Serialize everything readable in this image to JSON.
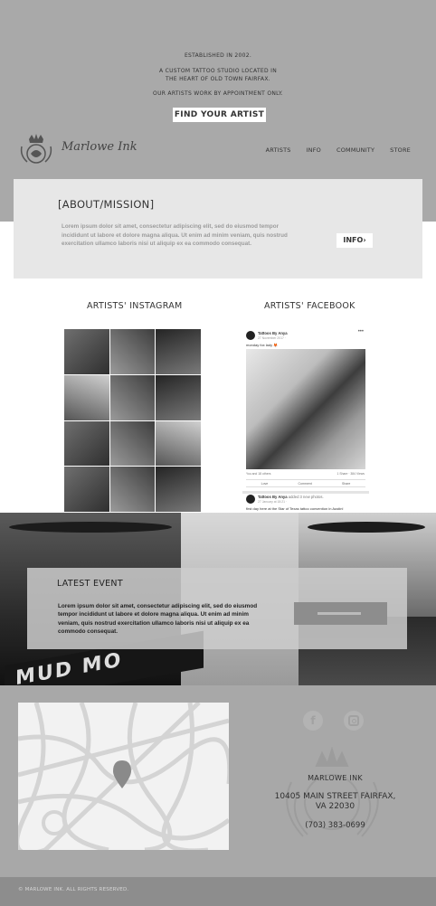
{
  "hero": {
    "established": "ESTABLISHED IN 2002.",
    "description": "A CUSTOM TATTOO STUDIO LOCATED IN THE HEART OF OLD TOWN FAIRFAX.",
    "appointment": "OUR ARTISTS WORK BY APPOINTMENT ONLY.",
    "cta_label": "FIND YOUR ARTIST"
  },
  "brand": {
    "name": "Marlowe Ink",
    "logo_icon": "crown-crest-logo"
  },
  "nav": {
    "items": [
      "ARTISTS",
      "INFO",
      "COMMUNITY",
      "STORE"
    ]
  },
  "about": {
    "title": "[ABOUT/MISSION]",
    "body": "Lorem ipsum dolor sit amet, consectetur adipiscing elit, sed do eiusmod tempor incididunt ut labore et dolore magna aliqua. Ut enim ad minim veniam, quis nostrud exercitation ullamco laboris nisi ut aliquip ex ea commodo consequat.",
    "button_label": "INFO›"
  },
  "social_feeds": {
    "instagram_title": "ARTISTS' INSTAGRAM",
    "facebook_title": "ARTISTS' FACEBOOK",
    "facebook_posts": [
      {
        "author": "Tattoos By Anya",
        "date": "27 November 2017 ·",
        "text": "monday fox lady 🦊",
        "reactions": "You and 18 others",
        "shares": "1 Share · 384 Views",
        "like": "Love",
        "comment": "Comment",
        "share": "Share"
      },
      {
        "author": "Tattoos By Anya",
        "action": "added 3 new photos.",
        "date": "27 January at 18:21 ·",
        "text": "first day here at the Star of Texas tattoo convention in Austin!"
      }
    ]
  },
  "event": {
    "title": "LATEST EVENT",
    "body": "Lorem ipsum dolor sit amet, consectetur adipiscing elit, sed do eiusmod tempor incididunt ut labore et dolore magna aliqua. Ut enim ad minim veniam, quis nostrud exercitation ullamco laboris nisi ut aliquip ex ea commodo consequat.",
    "marquee_text": "MUD MO"
  },
  "footer": {
    "social_icons": [
      "facebook-icon",
      "instagram-icon"
    ],
    "facebook_glyph": "f",
    "shop_name": "MARLOWE INK",
    "street": "10405 MAIN STREET  FAIRFAX,",
    "state_zip": "VA 22030",
    "phone": "(703) 383-0699",
    "copyright": "© MARLOWE INK.  ALL RIGHTS RESERVED."
  }
}
